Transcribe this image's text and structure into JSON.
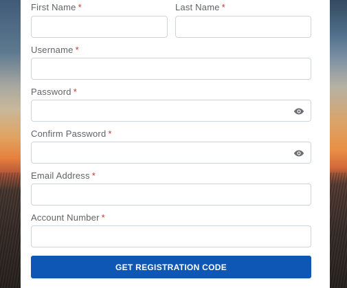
{
  "form": {
    "required_marker": "*",
    "first_name": {
      "label": "First Name",
      "value": "",
      "placeholder": ""
    },
    "last_name": {
      "label": "Last Name",
      "value": "",
      "placeholder": ""
    },
    "username": {
      "label": "Username",
      "value": "",
      "placeholder": ""
    },
    "password": {
      "label": "Password",
      "value": "",
      "placeholder": ""
    },
    "confirm_password": {
      "label": "Confirm Password",
      "value": "",
      "placeholder": ""
    },
    "email": {
      "label": "Email Address",
      "value": "",
      "placeholder": ""
    },
    "account_number": {
      "label": "Account Number",
      "value": "",
      "placeholder": ""
    },
    "submit_label": "GET REGISTRATION CODE"
  },
  "icons": {
    "password_toggle": "eye-icon",
    "confirm_password_toggle": "eye-icon"
  },
  "colors": {
    "primary_button": "#0f57b5",
    "required_marker": "#c0392b",
    "label_text": "#5f6368",
    "field_border": "#cfd4da"
  }
}
